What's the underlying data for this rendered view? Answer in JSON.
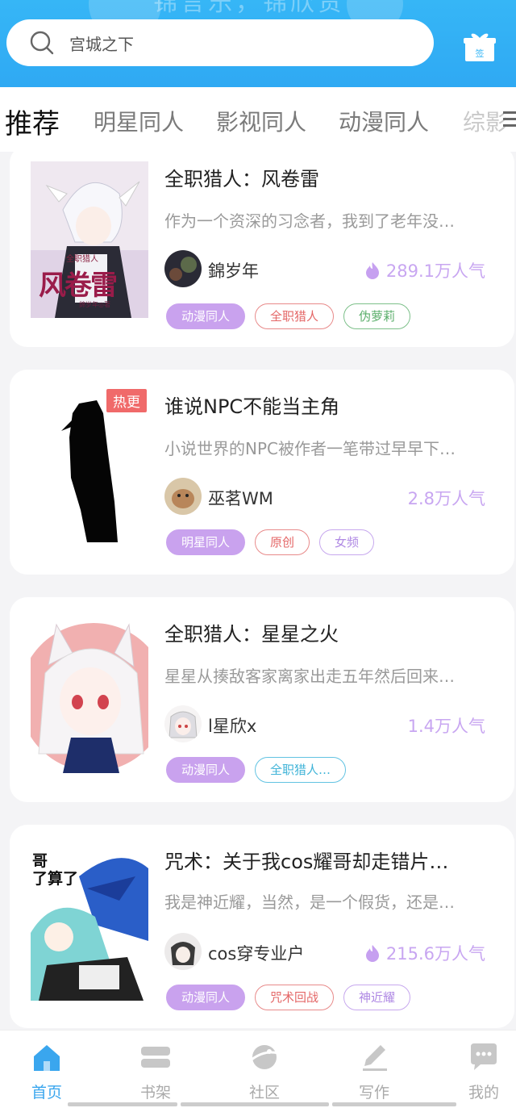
{
  "header": {
    "banner_text": "锦言乐，锦欣贵",
    "search_placeholder": "宫城之下",
    "gift_badge": "签"
  },
  "tabs": [
    "推荐",
    "明星同人",
    "影视同人",
    "动漫同人",
    "综影"
  ],
  "active_tab": "推荐",
  "books": [
    {
      "title": "全职猎人：风卷雷",
      "description": "作为一个资深的习念者，我到了老年没…",
      "author": "錦岁年",
      "popularity": "289.1万人气",
      "show_flame": true,
      "hot_badge": "",
      "cover_text_small": "全职猎人",
      "cover_text_big": "风卷雷",
      "cover_text_author": "錦岁年◎著",
      "tags": [
        {
          "label": "动漫同人",
          "style": "fill"
        },
        {
          "label": "全职猎人",
          "style": "red"
        },
        {
          "label": "伪萝莉",
          "style": "green"
        }
      ]
    },
    {
      "title": "谁说NPC不能当主角",
      "description": "小说世界的NPC被作者一笔带过早早下…",
      "author": "巫茗WM",
      "popularity": "2.8万人气",
      "show_flame": false,
      "hot_badge": "热更",
      "tags": [
        {
          "label": "明星同人",
          "style": "fill"
        },
        {
          "label": "原创",
          "style": "red"
        },
        {
          "label": "女频",
          "style": "purple"
        }
      ]
    },
    {
      "title": "全职猎人：星星之火",
      "description": "星星从揍敌客家离家出走五年然后回来…",
      "author": "l星欣x",
      "popularity": "1.4万人气",
      "show_flame": false,
      "hot_badge": "",
      "tags": [
        {
          "label": "动漫同人",
          "style": "fill"
        },
        {
          "label": "全职猎人…",
          "style": "blue"
        }
      ]
    },
    {
      "title": "咒术：关于我cos耀哥却走错片…",
      "description": "我是神近耀，当然，是一个假货，还是…",
      "author": "cos穿专业户",
      "popularity": "215.6万人气",
      "show_flame": true,
      "hot_badge": "",
      "cover_text_small": "哥",
      "cover_text_big": "了算了",
      "tags": [
        {
          "label": "动漫同人",
          "style": "fill"
        },
        {
          "label": "咒术回战",
          "style": "red"
        },
        {
          "label": "神近耀",
          "style": "purple"
        }
      ]
    }
  ],
  "bottom_nav": [
    {
      "label": "首页",
      "icon": "home-icon",
      "active": true
    },
    {
      "label": "书架",
      "icon": "bookshelf-icon",
      "active": false
    },
    {
      "label": "社区",
      "icon": "community-icon",
      "active": false
    },
    {
      "label": "写作",
      "icon": "write-icon",
      "active": false
    },
    {
      "label": "我的",
      "icon": "message-icon",
      "active": false
    }
  ],
  "colors": {
    "header_blue": "#36b6f6",
    "accent_purple": "#c9a2ee",
    "active_nav": "#3aa6ee"
  }
}
